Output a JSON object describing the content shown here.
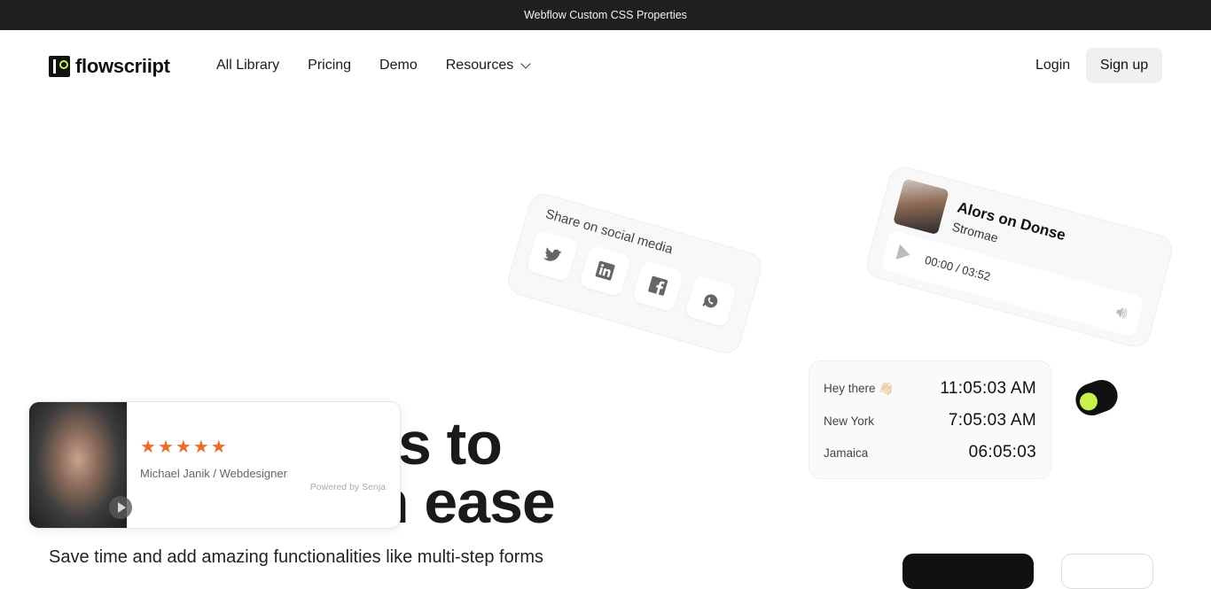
{
  "banner": {
    "text": "Webflow Custom CSS Properties"
  },
  "header": {
    "logo_text": "flowscriipt",
    "nav": [
      "All Library",
      "Pricing",
      "Demo",
      "Resources"
    ],
    "login_label": "Login",
    "signup_label": "Sign up"
  },
  "hero": {
    "line1": "alities to",
    "line2": "n ease",
    "subtitle": "Save time and add amazing functionalities like multi-step forms"
  },
  "share_card": {
    "title": "Share on social media",
    "icons": [
      "twitter-icon",
      "linkedin-icon",
      "facebook-icon",
      "whatsapp-icon"
    ]
  },
  "music_card": {
    "track": "Alors on Donse",
    "artist": "Stromae",
    "time": "00:00 / 03:52"
  },
  "clocks": [
    {
      "label": "Hey there 👋🏻",
      "time": "11:05:03 AM"
    },
    {
      "label": "New York",
      "time": "7:05:03 AM"
    },
    {
      "label": "Jamaica",
      "time": "06:05:03"
    }
  ],
  "review": {
    "stars": 5,
    "reviewer": "Michael Janik / Webdesigner",
    "powered_by": "Powered by Senja"
  },
  "colors": {
    "accent": "#c6f24a",
    "stars": "#f06b26",
    "topbar": "#1f1f1f"
  }
}
